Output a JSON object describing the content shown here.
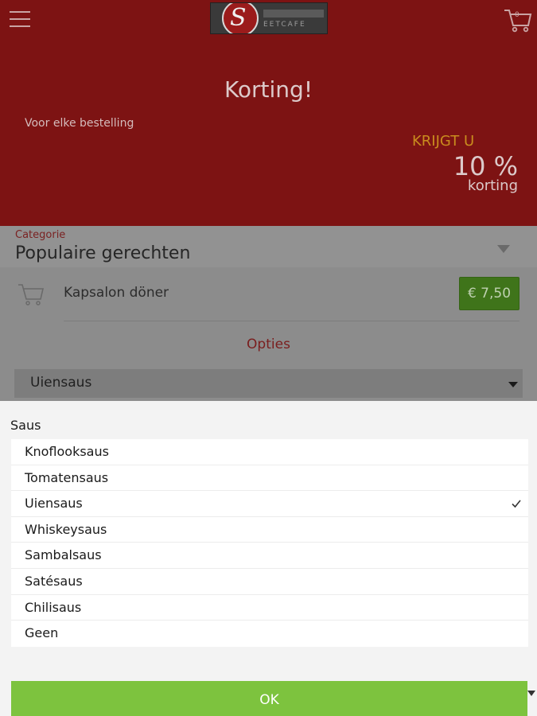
{
  "header": {
    "logo_text": "EETCAFE",
    "logo_letter": "S",
    "cart_count": "0"
  },
  "hero": {
    "title": "Korting!",
    "subtitle": "Voor elke bestelling",
    "krijgt": "KRIJGT U",
    "percent": "10 %",
    "korting": "korting"
  },
  "category": {
    "label": "Categorie",
    "value": "Populaire gerechten"
  },
  "product": {
    "name": "Kapsalon döner",
    "price": "€ 7,50"
  },
  "options": {
    "heading": "Opties",
    "selected": "Uiensaus"
  },
  "sheet": {
    "title": "Saus",
    "items": [
      {
        "label": "Knoflooksaus",
        "checked": false
      },
      {
        "label": "Tomatensaus",
        "checked": false
      },
      {
        "label": "Uiensaus",
        "checked": true
      },
      {
        "label": "Whiskeysaus",
        "checked": false
      },
      {
        "label": "Sambalsaus",
        "checked": false
      },
      {
        "label": "Satésaus",
        "checked": false
      },
      {
        "label": "Chilisaus",
        "checked": false
      },
      {
        "label": "Geen",
        "checked": false
      }
    ],
    "ok_label": "OK"
  },
  "colors": {
    "hero_bg": "#7d1313",
    "accent_orange": "#c98c1e",
    "price_green": "#3f741a",
    "ok_green": "#7dc33e"
  },
  "icons": {
    "menu": "hamburger-menu-icon",
    "cart": "shopping-cart-icon",
    "check": "checkmark-icon",
    "dropdown": "chevron-down-icon"
  }
}
